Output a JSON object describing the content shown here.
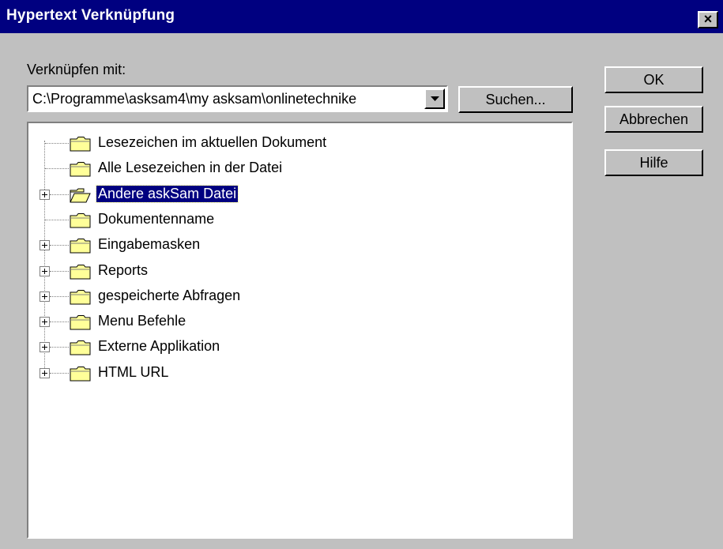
{
  "window": {
    "title": "Hypertext Verknüpfung",
    "close_symbol": "×"
  },
  "link": {
    "label": "Verknüpfen mit:",
    "value": "C:\\Programme\\asksam4\\my asksam\\onlinetechnike",
    "search_button": "Suchen..."
  },
  "buttons": {
    "ok": "OK",
    "cancel": "Abbrechen",
    "help": "Hilfe"
  },
  "tree": {
    "items": [
      {
        "label": "Lesezeichen im aktuellen Dokument",
        "expandable": false,
        "selected": false,
        "open": false
      },
      {
        "label": "Alle Lesezeichen in der Datei",
        "expandable": false,
        "selected": false,
        "open": false
      },
      {
        "label": "Andere askSam Datei",
        "expandable": true,
        "selected": true,
        "open": true
      },
      {
        "label": "Dokumentenname",
        "expandable": false,
        "selected": false,
        "open": false
      },
      {
        "label": "Eingabemasken",
        "expandable": true,
        "selected": false,
        "open": false
      },
      {
        "label": "Reports",
        "expandable": true,
        "selected": false,
        "open": false
      },
      {
        "label": "gespeicherte Abfragen",
        "expandable": true,
        "selected": false,
        "open": false
      },
      {
        "label": "Menu Befehle",
        "expandable": true,
        "selected": false,
        "open": false
      },
      {
        "label": "Externe Applikation",
        "expandable": true,
        "selected": false,
        "open": false
      },
      {
        "label": "HTML URL",
        "expandable": true,
        "selected": false,
        "open": false
      }
    ]
  },
  "colors": {
    "titlebar": "#000080",
    "selection": "#000080",
    "face": "#c0c0c0",
    "folder": "#ffff99"
  }
}
